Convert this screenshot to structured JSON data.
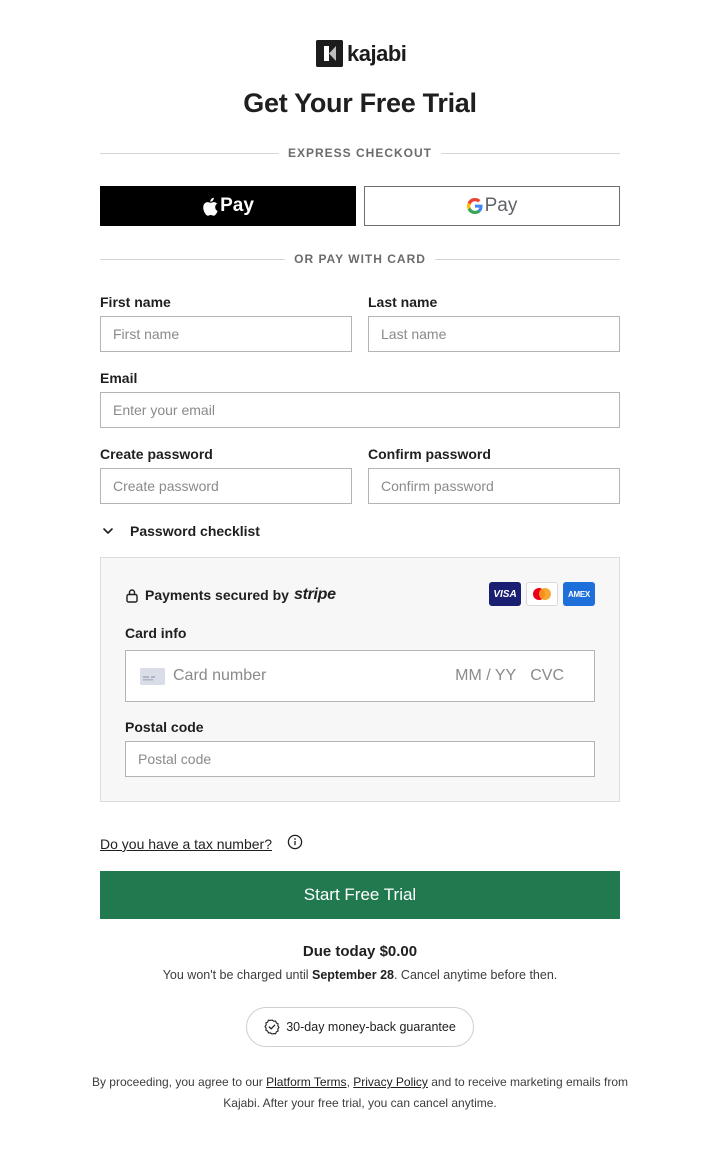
{
  "brand": {
    "logo_text": "kajabi"
  },
  "page": {
    "title": "Get Your Free Trial"
  },
  "express": {
    "divider_label": "EXPRESS CHECKOUT",
    "apple_pay_label": "Pay",
    "google_pay_label": "Pay"
  },
  "card_divider": {
    "label": "OR PAY WITH CARD"
  },
  "form": {
    "first_name": {
      "label": "First name",
      "placeholder": "First name"
    },
    "last_name": {
      "label": "Last name",
      "placeholder": "Last name"
    },
    "email": {
      "label": "Email",
      "placeholder": "Enter your email"
    },
    "password": {
      "label": "Create password",
      "placeholder": "Create password"
    },
    "confirm_password": {
      "label": "Confirm password",
      "placeholder": "Confirm password"
    },
    "checklist_label": "Password checklist"
  },
  "payment": {
    "secured_text": "Payments secured by",
    "stripe_word": "stripe",
    "brands": [
      "VISA",
      "AMEX"
    ],
    "card_info_label": "Card info",
    "card_number_placeholder": "Card number",
    "expiry_placeholder": "MM / YY",
    "cvc_placeholder": "CVC",
    "postal_label": "Postal code",
    "postal_placeholder": "Postal code"
  },
  "tax": {
    "link_text": "Do you have a tax number?"
  },
  "cta": {
    "label": "Start Free Trial"
  },
  "summary": {
    "due_today": "Due today $0.00",
    "charge_prefix": "You won't be charged until ",
    "charge_date": "September 28",
    "charge_suffix": ". Cancel anytime before then."
  },
  "guarantee": {
    "label": "30-day money-back guarantee"
  },
  "legal": {
    "prefix": "By proceeding, you agree to our ",
    "terms_link": "Platform Terms",
    "separator": ", ",
    "privacy_link": "Privacy Policy",
    "suffix": " and to receive marketing emails from Kajabi. After your free trial, you can cancel anytime."
  },
  "colors": {
    "cta_green": "#217a4f",
    "text_dark": "#1f1f1f",
    "border": "#b3b3b3",
    "panel_bg": "#f7f7f7"
  }
}
